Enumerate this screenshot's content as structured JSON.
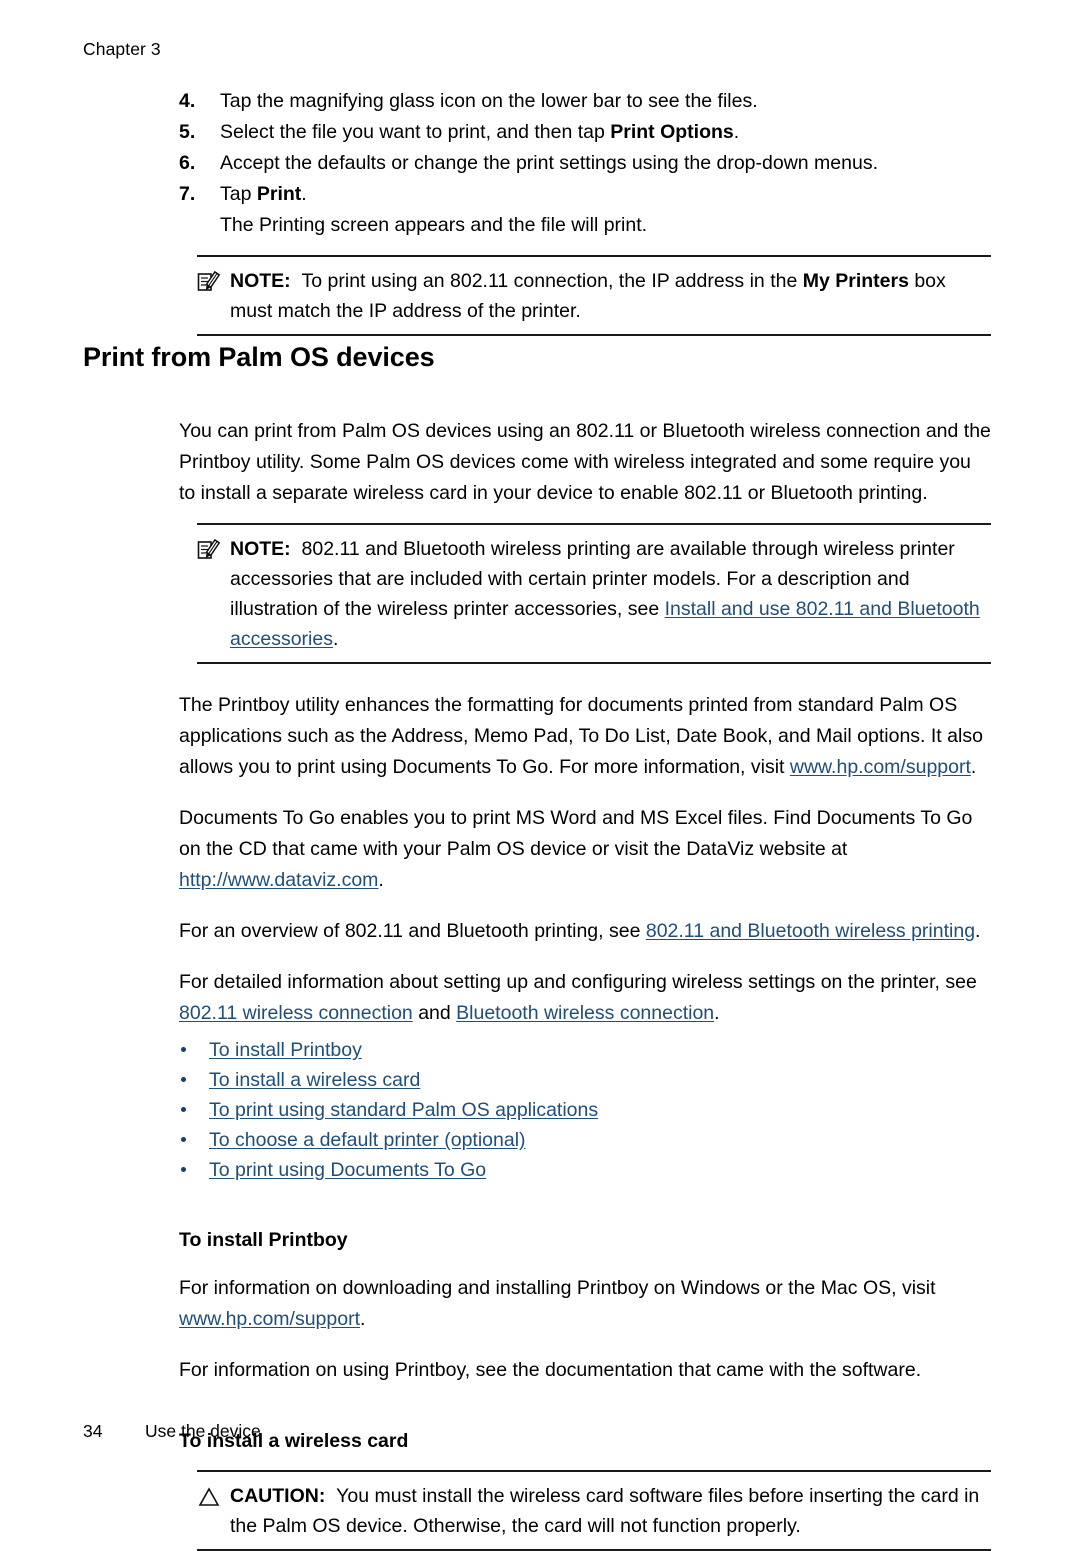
{
  "header": {
    "running_head": "Chapter 3"
  },
  "steps": [
    {
      "num": "4.",
      "text_before": "Tap the magnifying glass icon on the lower bar to see the files.",
      "bold": "",
      "text_after": ""
    },
    {
      "num": "5.",
      "text_before": "Select the file you want to print, and then tap ",
      "bold": "Print Options",
      "text_after": "."
    },
    {
      "num": "6.",
      "text_before": "Accept the defaults or change the print settings using the drop-down menus.",
      "bold": "",
      "text_after": ""
    },
    {
      "num": "7.",
      "text_before": "Tap ",
      "bold": "Print",
      "text_after": "."
    }
  ],
  "step_continuation": "The Printing screen appears and the file will print.",
  "note1": {
    "icon": "note-pencil-icon",
    "label": "NOTE:",
    "text_before": "To print using an 802.11 connection, the IP address in the ",
    "bold": "My Printers",
    "text_after": " box must match the IP address of the printer."
  },
  "section": {
    "title": "Print from Palm OS devices",
    "intro": "You can print from Palm OS devices using an 802.11 or Bluetooth wireless connection and the Printboy utility. Some Palm OS devices come with wireless integrated and some require you to install a separate wireless card in your device to enable 802.11 or Bluetooth printing."
  },
  "note2": {
    "icon": "note-pencil-icon",
    "label": "NOTE:",
    "text_before": "802.11 and Bluetooth wireless printing are available through wireless printer accessories that are included with certain printer models. For a description and illustration of the wireless printer accessories, see ",
    "link": "Install and use 802.11 and Bluetooth accessories",
    "text_after": "."
  },
  "paragraphs": {
    "printboy_before": "The Printboy utility enhances the formatting for documents printed from standard Palm OS applications such as the Address, Memo Pad, To Do List, Date Book, and Mail options. It also allows you to print using Documents To Go. For more information, visit ",
    "printboy_link": "www.hp.com/support",
    "printboy_after": ".",
    "dataviz_before": "Documents To Go enables you to print MS Word and MS Excel files. Find Documents To Go on the CD that came with your Palm OS device or visit the DataViz website at ",
    "dataviz_link": "http://www.dataviz.com",
    "dataviz_after": ".",
    "overview_before": "For an overview of 802.11 and Bluetooth printing, see ",
    "overview_link": "802.11 and Bluetooth wireless printing",
    "overview_after": ".",
    "detail_before": "For detailed information about setting up and configuring wireless settings on the printer, see ",
    "detail_link1": "802.11 wireless connection",
    "detail_mid": " and ",
    "detail_link2": "Bluetooth wireless connection",
    "detail_after": "."
  },
  "bullet_links": [
    {
      "label": "To install Printboy"
    },
    {
      "label": "To install a wireless card"
    },
    {
      "label": "To print using standard Palm OS applications"
    },
    {
      "label": "To choose a default printer (optional)"
    },
    {
      "label": "To print using Documents To Go"
    }
  ],
  "subsections": {
    "printboy_heading": "To install Printboy",
    "printboy_p1_before": "For information on downloading and installing Printboy on Windows or the Mac OS, visit ",
    "printboy_p1_link": "www.hp.com/support",
    "printboy_p1_after": ".",
    "printboy_p2": "For information on using Printboy, see the documentation that came with the software.",
    "wireless_card_heading": "To install a wireless card"
  },
  "caution": {
    "icon": "warning-triangle-icon",
    "label": "CAUTION:",
    "text": "You must install the wireless card software files before inserting the card in the Palm OS device. Otherwise, the card will not function properly."
  },
  "footer": {
    "page_number": "34",
    "section_name": "Use the device"
  },
  "colors": {
    "link": "#1F4E79",
    "text": "#000000",
    "rule": "#1a1a1a"
  }
}
